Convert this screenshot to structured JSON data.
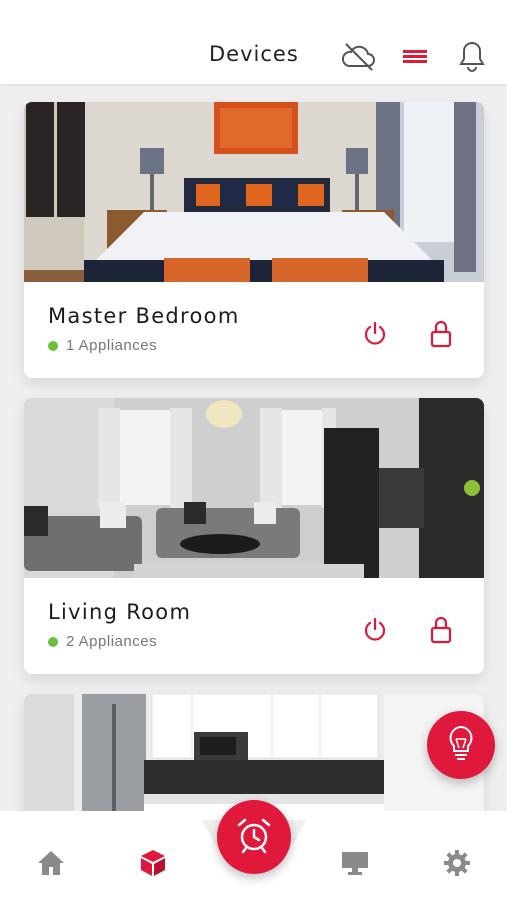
{
  "header": {
    "title": "Devices",
    "icons": [
      "cloud-off-icon",
      "menu-icon",
      "bell-icon"
    ]
  },
  "rooms": [
    {
      "name": "Master Bedroom",
      "status": "1 Appliances",
      "image": "bedroom-photo"
    },
    {
      "name": "Living Room",
      "status": "2 Appliances",
      "image": "living-room-photo"
    },
    {
      "name": "",
      "status": "",
      "image": "kitchen-photo"
    }
  ],
  "card_actions": [
    "power-icon",
    "lock-icon"
  ],
  "fab": {
    "icon": "lightbulb-icon"
  },
  "tabbar": {
    "tabs": [
      "home-icon",
      "cube-icon",
      "alarm-clock-icon",
      "monitor-icon",
      "gear-icon"
    ],
    "active": "cube-icon"
  },
  "colors": {
    "accent": "#e0183c",
    "status_online": "#6cbf3a",
    "background": "#efefef",
    "inactive_icon": "#8a8a8a"
  }
}
